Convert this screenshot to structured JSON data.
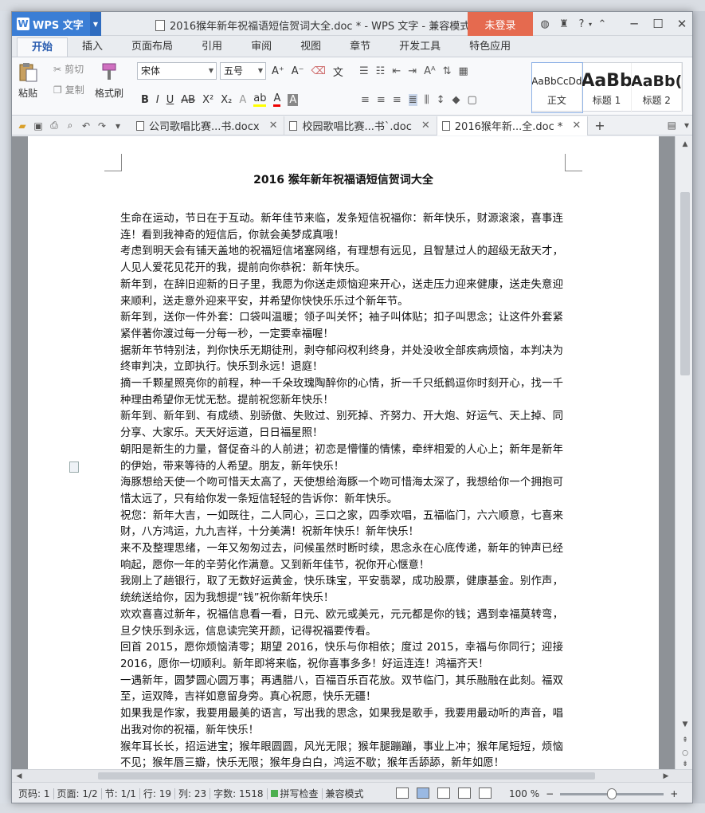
{
  "app": {
    "name": "WPS 文字",
    "logo": "W",
    "window_title": "2016猴年新年祝福语短信贺词大全.doc * - WPS 文字 - 兼容模式",
    "login": "未登录",
    "help": "?"
  },
  "ribbon_tabs": [
    "开始",
    "插入",
    "页面布局",
    "引用",
    "审阅",
    "视图",
    "章节",
    "开发工具",
    "特色应用"
  ],
  "toolbar": {
    "paste": "粘贴",
    "cut": "剪切",
    "copy": "复制",
    "format_painter": "格式刷",
    "font_name": "宋体",
    "font_size": "五号",
    "styles": [
      {
        "sample": "AaBbCcDd",
        "name": "正文"
      },
      {
        "sample": "AaBb",
        "name": "标题 1"
      },
      {
        "sample": "AaBb(",
        "name": "标题 2"
      }
    ]
  },
  "doc_tabs": [
    {
      "label": "公司歌唱比赛...书.docx",
      "active": false
    },
    {
      "label": "校园歌唱比赛...书`.doc",
      "active": false
    },
    {
      "label": "2016猴年新...全.doc *",
      "active": true
    }
  ],
  "document": {
    "title": "2016 猴年新年祝福语短信贺词大全",
    "paragraphs": [
      "生命在运动，节日在于互动。新年佳节来临，发条短信祝福你：新年快乐，财源滚滚，喜事连连！看到我神奇的短信后，你就会美梦成真哦！",
      "考虑到明天会有铺天盖地的祝福短信堵塞网络，有理想有远见，且智慧过人的超级无敌天才，人见人爱花见花开的我，提前向你恭祝：新年快乐。",
      "新年到，在辞旧迎新的日子里，我愿为你送走烦恼迎来开心，送走压力迎来健康，送走失意迎来顺利，送走意外迎来平安，并希望你快快乐乐过个新年节。",
      "新年到，送你一件外套：口袋叫温暖；领子叫关怀；袖子叫体贴；扣子叫思念；让这件外套紧紧伴著你渡过每一分每一秒，一定要幸福喔！",
      "据新年节特别法，判你快乐无期徒刑，剥夺郁闷权利终身，并处没收全部疾病烦恼，本判决为终审判决，立即执行。快乐到永远！退庭！",
      "摘一千颗星照亮你的前程，种一千朵玫瑰陶醉你的心情，折一千只纸鹤逗你时刻开心，找一千种理由希望你无忧无愁。提前祝您新年快乐！",
      "新年到、新年到、有成绩、别骄傲、失败过、别死掉、齐努力、开大炮、好运气、天上掉、同分享、大家乐。天天好运道，日日福星照！",
      "朝阳是新生的力量，督促奋斗的人前进；初恋是懵懂的情愫，牵绊相爱的人心上；新年是新年的伊始，带来等待的人希望。朋友，新年快乐！",
      "海豚想给天使一个吻可惜天太高了，天使想给海豚一个吻可惜海太深了，我想给你一个拥抱可惜太远了，只有给你发一条短信轻轻的告诉你：新年快乐。",
      "祝您：新年大吉，一如既往，二人同心，三口之家，四季欢唱，五福临门，六六顺意，七喜来财，八方鸿运，九九吉祥，十分美满！祝新年快乐！新年快乐！",
      "来不及整理思绪，一年又匆匆过去，问候虽然时断时续，思念永在心底传递，新年的钟声已经响起，愿你一年的辛劳化作满意。又到新年佳节，祝你开心惬意！",
      "我刚上了趟银行，取了无数好运黄金，快乐珠宝，平安翡翠，成功股票，健康基金。别作声，统统送给你，因为我想提“钱”祝你新年快乐！",
      "欢欢喜喜过新年，祝福信息看一看，日元、欧元或美元，元元都是你的钱；遇到幸福莫转弯，旦夕快乐到永远，信息读完笑开颜，记得祝福要传看。",
      "回首 2015，愿你烦恼清零；期望 2016，快乐与你相依；度过 2015，幸福与你同行；迎接2016，愿你一切顺利。新年即将来临，祝你喜事多多！好运连连！鸿福齐天！",
      "一遇新年，圆梦圆心圆万事；再遇腊八，百福百乐百花放。双节临门，其乐融融在此刻。福双至，运双降，吉祥如意留身旁。真心祝愿，快乐无疆！",
      "如果我是作家，我要用最美的语言，写出我的思念，如果我是歌手，我要用最动听的声音，唱出我对你的祝福，新年快乐！",
      "猴年耳长长，招运进宝；猴年眼圆圆，风光无限；猴年腿蹦蹦，事业上冲；猴年尾短短，烦恼不见；猴年唇三瓣，快乐无限；猴年身白白，鸿运不歇；猴年舌舔舔，新年如愿！"
    ]
  },
  "status": {
    "page": "页码: 1",
    "pages": "页面: 1/2",
    "section": "节: 1/1",
    "row": "行: 19",
    "col": "列: 23",
    "word_count": "字数: 1518",
    "spell": "拼写检查",
    "compat": "兼容模式",
    "zoom": "100 %"
  },
  "colors": {
    "accent": "#3b7ed5",
    "login": "#e56a4f",
    "spell_ok": "#4caf50"
  },
  "zoom_fraction": 0.5
}
